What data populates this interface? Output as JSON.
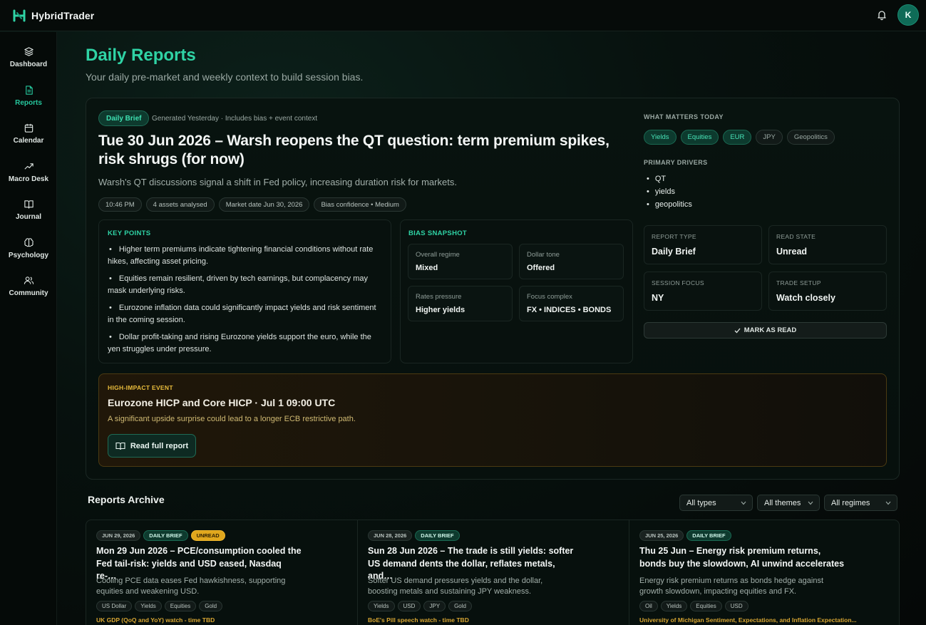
{
  "app": {
    "name": "HybridTrader",
    "avatar_initial": "K",
    "accent": "#2fd3a5"
  },
  "nav": [
    {
      "label": "Dashboard",
      "icon": "layers-icon",
      "active": false
    },
    {
      "label": "Reports",
      "icon": "document-icon",
      "active": true
    },
    {
      "label": "Calendar",
      "icon": "calendar-icon",
      "active": false
    },
    {
      "label": "Macro Desk",
      "icon": "trend-icon",
      "active": false
    },
    {
      "label": "Journal",
      "icon": "book-icon",
      "active": false
    },
    {
      "label": "Psychology",
      "icon": "brain-icon",
      "active": false
    },
    {
      "label": "Community",
      "icon": "users-icon",
      "active": false
    }
  ],
  "page": {
    "title": "Daily Reports",
    "subtitle": "Your daily pre-market and weekly context to build session bias."
  },
  "featured": {
    "type_pill": "Daily Brief",
    "generated": "Generated Yesterday · Includes bias + event context",
    "headline": "Tue 30 Jun 2026 – Warsh reopens the QT question: term premium spikes, risk shrugs (for now)",
    "summary": "Warsh's QT discussions signal a shift in Fed policy, increasing duration risk for markets.",
    "chips": [
      "10:46 PM",
      "4 assets analysed",
      "Market date Jun 30, 2026",
      "Bias confidence • Medium"
    ],
    "key_points_title": "KEY POINTS",
    "key_points": [
      "Higher term premiums indicate tightening financial conditions without rate hikes, affecting asset pricing.",
      "Equities remain resilient, driven by tech earnings, but complacency may mask underlying risks.",
      "Eurozone inflation data could significantly impact yields and risk sentiment in the coming session.",
      "Dollar profit-taking and rising Eurozone yields support the euro, while the yen struggles under pressure."
    ],
    "bias_title": "BIAS SNAPSHOT",
    "bias": [
      {
        "label": "Overall regime",
        "value": "Mixed"
      },
      {
        "label": "Dollar tone",
        "value": "Offered"
      },
      {
        "label": "Rates pressure",
        "value": "Higher yields"
      },
      {
        "label": "Focus complex",
        "value": "FX • INDICES • BONDS"
      }
    ],
    "what_matters_title": "WHAT MATTERS TODAY",
    "what_matters": [
      {
        "label": "Yields",
        "highlight": true
      },
      {
        "label": "Equities",
        "highlight": true
      },
      {
        "label": "EUR",
        "highlight": true
      },
      {
        "label": "JPY",
        "highlight": false
      },
      {
        "label": "Geopolitics",
        "highlight": false
      }
    ],
    "drivers_title": "PRIMARY DRIVERS",
    "drivers": [
      "QT",
      "yields",
      "geopolitics"
    ],
    "meta": [
      {
        "label": "REPORT TYPE",
        "value": "Daily Brief"
      },
      {
        "label": "READ STATE",
        "value": "Unread"
      },
      {
        "label": "SESSION FOCUS",
        "value": "NY"
      },
      {
        "label": "TRADE SETUP",
        "value": "Watch closely"
      }
    ],
    "mark_read": "MARK AS READ",
    "event": {
      "kicker": "HIGH-IMPACT EVENT",
      "title": "Eurozone HICP and Core HICP · Jul 1 09:00 UTC",
      "desc": "A significant upside surprise could lead to a longer ECB restrictive path.",
      "button": "Read full report"
    }
  },
  "archive": {
    "title": "Reports Archive",
    "filters": [
      "All types",
      "All themes",
      "All regimes"
    ],
    "cards": [
      {
        "date": "JUN 29, 2026",
        "type": "DAILY BRIEF",
        "status": "UNREAD",
        "title": "Mon 29 Jun 2026 – PCE/consumption cooled the Fed tail-risk: yields and USD eased, Nasdaq re-…",
        "summary": "Cooling PCE data eases Fed hawkishness, supporting equities and weakening USD.",
        "tags": [
          "US Dollar",
          "Yields",
          "Equities",
          "Gold"
        ],
        "watch": "UK GDP (QoQ and YoY) watch - time TBD"
      },
      {
        "date": "JUN 28, 2026",
        "type": "DAILY BRIEF",
        "status": "",
        "title": "Sun 28 Jun 2026 – The trade is still yields: softer US demand dents the dollar, reflates metals, and…",
        "summary": "Softer US demand pressures yields and the dollar, boosting metals and sustaining JPY weakness.",
        "tags": [
          "Yields",
          "USD",
          "JPY",
          "Gold"
        ],
        "watch": "BoE's Pill speech watch - time TBD"
      },
      {
        "date": "JUN 25, 2026",
        "type": "DAILY BRIEF",
        "status": "",
        "title": "Thu 25 Jun – Energy risk premium returns, bonds buy the slowdown, AI unwind accelerates",
        "summary": "Energy risk premium returns as bonds hedge against growth slowdown, impacting equities and FX.",
        "tags": [
          "Oil",
          "Yields",
          "Equities",
          "USD"
        ],
        "watch": "University of Michigan Sentiment, Expectations, and Inflation Expectation..."
      }
    ]
  }
}
